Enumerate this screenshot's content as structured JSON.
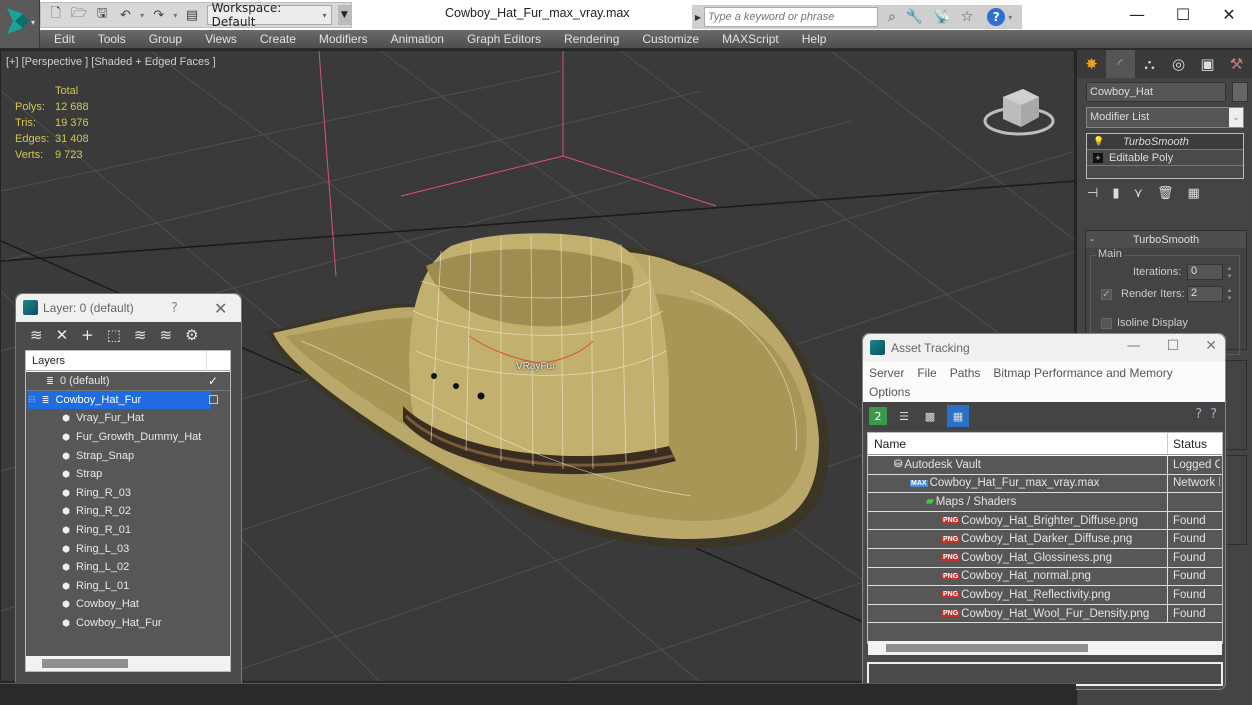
{
  "app": {
    "title": "Cowboy_Hat_Fur_max_vray.max",
    "workspace": "Workspace: Default",
    "search_placeholder": "Type a keyword or phrase"
  },
  "menu": [
    "Edit",
    "Tools",
    "Group",
    "Views",
    "Create",
    "Modifiers",
    "Animation",
    "Graph Editors",
    "Rendering",
    "Customize",
    "MAXScript",
    "Help"
  ],
  "viewport": {
    "label": "[+] [Perspective ] [Shaded + Edged Faces ]",
    "stats": {
      "header": "Total",
      "rows": [
        {
          "key": "Polys:",
          "value": "12 688"
        },
        {
          "key": "Tris:",
          "value": "19 376"
        },
        {
          "key": "Edges:",
          "value": "31 408"
        },
        {
          "key": "Verts:",
          "value": "9 723"
        }
      ]
    },
    "object_label": "VRayFur"
  },
  "command_panel": {
    "object_name": "Cowboy_Hat",
    "modifier_list": "Modifier List",
    "stack": [
      "TurboSmooth",
      "Editable Poly"
    ],
    "rollout": {
      "title": "TurboSmooth",
      "group": "Main",
      "iterations_label": "Iterations:",
      "iterations": "0",
      "render_iters_label": "Render Iters:",
      "render_iters": "2",
      "render_iters_checked": true,
      "isoline_label": "Isoline Display",
      "isoline_checked": false
    }
  },
  "layer_dialog": {
    "title": "Layer: 0 (default)",
    "help": "?",
    "column": "Layers",
    "layers": [
      {
        "name": "0 (default)",
        "type": "layer",
        "level": 0,
        "current": true
      },
      {
        "name": "Cowboy_Hat_Fur",
        "type": "layer",
        "level": 0,
        "selected": true
      },
      {
        "name": "Vray_Fur_Hat",
        "type": "object",
        "level": 1
      },
      {
        "name": "Fur_Growth_Dummy_Hat",
        "type": "object",
        "level": 1
      },
      {
        "name": "Strap_Snap",
        "type": "object",
        "level": 1
      },
      {
        "name": "Strap",
        "type": "object",
        "level": 1
      },
      {
        "name": "Ring_R_03",
        "type": "object",
        "level": 1
      },
      {
        "name": "Ring_R_02",
        "type": "object",
        "level": 1
      },
      {
        "name": "Ring_R_01",
        "type": "object",
        "level": 1
      },
      {
        "name": "Ring_L_03",
        "type": "object",
        "level": 1
      },
      {
        "name": "Ring_L_02",
        "type": "object",
        "level": 1
      },
      {
        "name": "Ring_L_01",
        "type": "object",
        "level": 1
      },
      {
        "name": "Cowboy_Hat",
        "type": "object",
        "level": 1
      },
      {
        "name": "Cowboy_Hat_Fur",
        "type": "object",
        "level": 1
      }
    ]
  },
  "asset_dialog": {
    "title": "Asset Tracking",
    "menu": [
      "Server",
      "File",
      "Paths",
      "Bitmap Performance and Memory",
      "Options"
    ],
    "columns": [
      "Name",
      "Status"
    ],
    "rows": [
      {
        "name": "Autodesk Vault",
        "status": "Logged C",
        "icon": "vault",
        "level": 1
      },
      {
        "name": "Cowboy_Hat_Fur_max_vray.max",
        "status": "Network I",
        "icon": "max",
        "level": 2
      },
      {
        "name": "Maps / Shaders",
        "status": "",
        "icon": "maps",
        "level": 3
      },
      {
        "name": "Cowboy_Hat_Brighter_Diffuse.png",
        "status": "Found",
        "icon": "png",
        "level": 4
      },
      {
        "name": "Cowboy_Hat_Darker_Diffuse.png",
        "status": "Found",
        "icon": "png",
        "level": 4
      },
      {
        "name": "Cowboy_Hat_Glossiness.png",
        "status": "Found",
        "icon": "png",
        "level": 4
      },
      {
        "name": "Cowboy_Hat_normal.png",
        "status": "Found",
        "icon": "png",
        "level": 4
      },
      {
        "name": "Cowboy_Hat_Reflectivity.png",
        "status": "Found",
        "icon": "png",
        "level": 4
      },
      {
        "name": "Cowboy_Hat_Wool_Fur_Density.png",
        "status": "Found",
        "icon": "png",
        "level": 4
      }
    ],
    "path_value": ""
  },
  "colors": {
    "stats_text": "#d4c84a",
    "selection": "#1e6ce0",
    "png_badge": "#c0332c"
  }
}
